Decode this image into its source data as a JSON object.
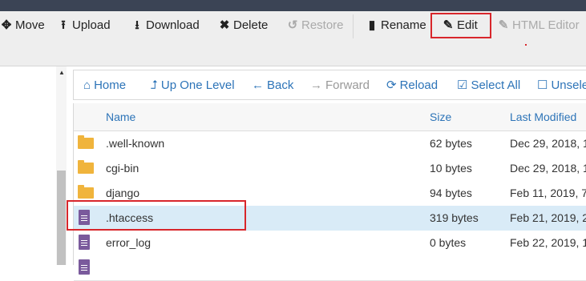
{
  "toolbar": {
    "move": "Move",
    "upload": "Upload",
    "download": "Download",
    "delete": "Delete",
    "restore": "Restore",
    "rename": "Rename",
    "edit": "Edit",
    "html_editor": "HTML Editor"
  },
  "nav": {
    "home": "Home",
    "up_one_level": "Up One Level",
    "back": "Back",
    "forward": "Forward",
    "reload": "Reload",
    "select_all": "Select All",
    "unselect": "Unsele"
  },
  "table": {
    "headers": {
      "name": "Name",
      "size": "Size",
      "modified": "Last Modified"
    },
    "rows": [
      {
        "name": ".well-known",
        "size": "62 bytes",
        "modified": "Dec 29, 2018, 1",
        "type": "folder-icon"
      },
      {
        "name": "cgi-bin",
        "size": "10 bytes",
        "modified": "Dec 29, 2018, 1",
        "type": "folder-icon"
      },
      {
        "name": "django",
        "size": "94 bytes",
        "modified": "Feb 11, 2019, 7",
        "type": "folder-icon"
      },
      {
        "name": ".htaccess",
        "size": "319 bytes",
        "modified": "Feb 21, 2019, 2",
        "type": "file-icon",
        "selected": true
      },
      {
        "name": "error_log",
        "size": "0 bytes",
        "modified": "Feb 22, 2019, 1",
        "type": "file-icon"
      },
      {
        "name": "",
        "size": "",
        "modified": "",
        "type": "file-icon"
      }
    ]
  },
  "colors": {
    "highlight_box": "#d8262b",
    "link_blue": "#2d74b8",
    "selected_row": "#d9ebf7"
  }
}
